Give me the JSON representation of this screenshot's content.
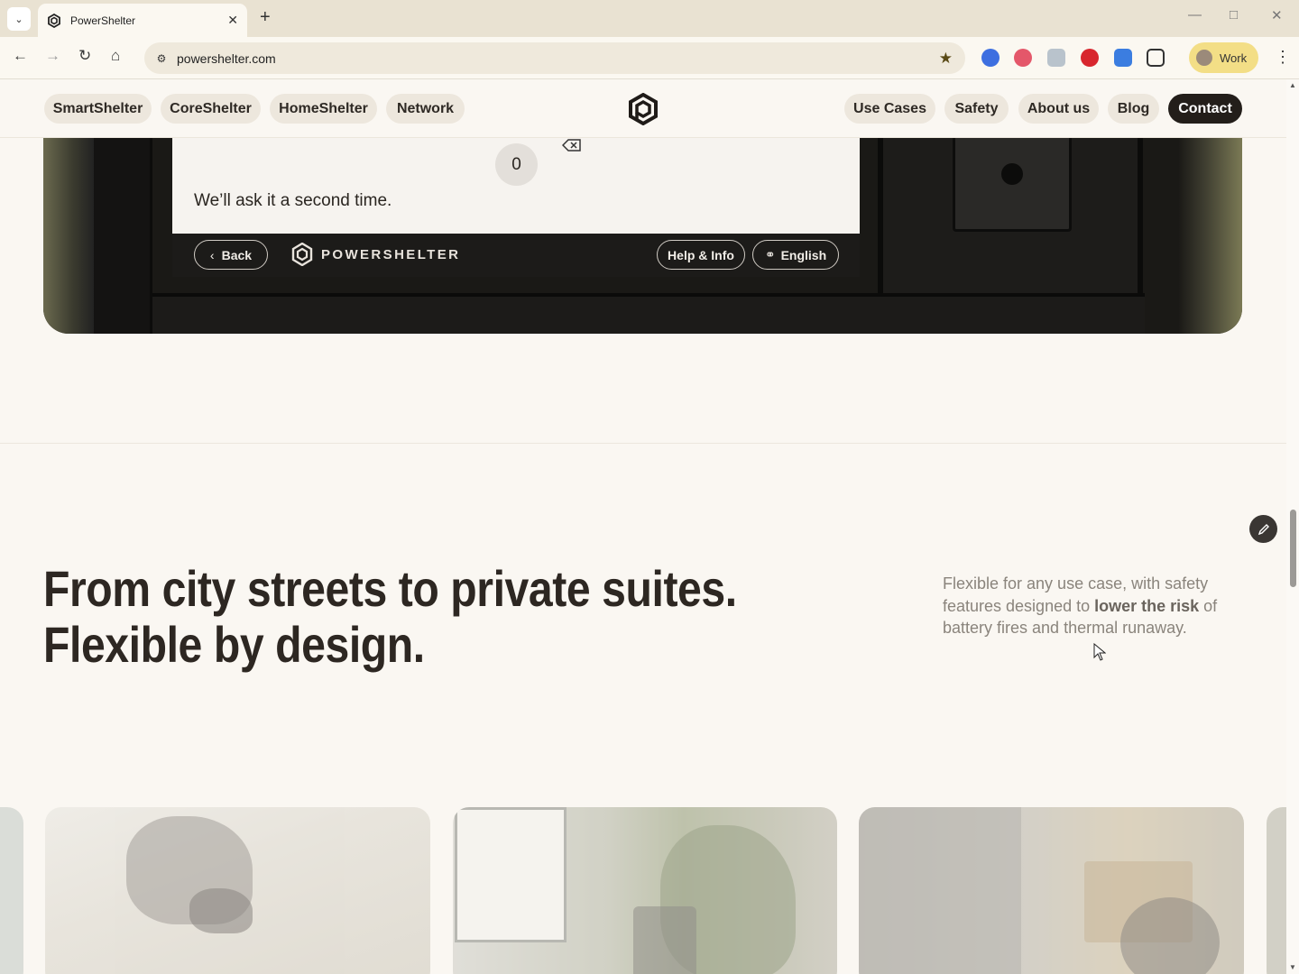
{
  "browser": {
    "tab_title": "PowerShelter",
    "url": "powershelter.com",
    "profile_label": "Work",
    "icons": [
      "tab-search-icon",
      "favicon",
      "close-icon",
      "new-tab-icon",
      "back-icon",
      "forward-icon",
      "reload-icon",
      "home-icon",
      "site-settings-icon",
      "bookmark-star-icon",
      "extensions-icon",
      "menu-icon"
    ]
  },
  "site_nav": {
    "left_items": [
      "SmartShelter",
      "CoreShelter",
      "HomeShelter",
      "Network"
    ],
    "right_items": [
      "Use Cases",
      "Safety",
      "About us",
      "Blog"
    ],
    "contact_label": "Contact"
  },
  "hero": {
    "keypad_digit": "0",
    "message": "We’ll ask it a second time.",
    "back_label": "Back",
    "brand_label": "POWERSHELTER",
    "help_label": "Help & Info",
    "language_label": "English"
  },
  "section": {
    "headline_line1": "From city streets to private suites.",
    "headline_line2": "Flexible by design.",
    "side_text_part1": "Flexible for any use case, with safety features designed to ",
    "side_text_bold": "lower the risk",
    "side_text_part2": " of battery fires and thermal runaway."
  },
  "colors": {
    "background": "#faf7f2",
    "pill": "#ede7dd",
    "contact": "#231e1a",
    "text": "#2d2722",
    "muted": "#8a847c"
  }
}
